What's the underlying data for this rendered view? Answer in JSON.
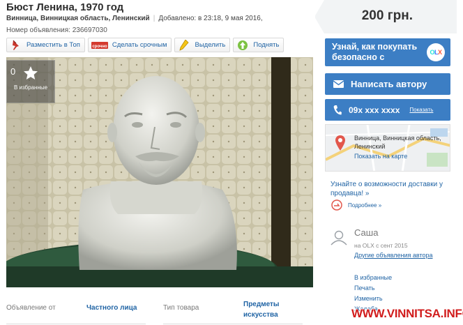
{
  "listing": {
    "title": "Бюст Ленина, 1970 год",
    "location": "Винница, Винницкая область, Ленинский",
    "added": "Добавлено: в 23:18, 9 мая 2016,",
    "ad_number": "Номер объявления: 236697030"
  },
  "actions": [
    {
      "label": "Разместить в Топ",
      "icon": "pin-icon"
    },
    {
      "label": "Сделать срочным",
      "icon": "urgent-badge-icon",
      "badge": "срочно"
    },
    {
      "label": "Выделить",
      "icon": "highlighter-icon"
    },
    {
      "label": "Поднять",
      "icon": "arrow-up-icon"
    }
  ],
  "photo": {
    "favorite_label": "В избранные",
    "favorite_prefix": "0"
  },
  "details": {
    "from_label": "Объявление от",
    "from_value": "Частного лица",
    "type_label": "Тип товара",
    "type_value": "Предметы искусства"
  },
  "sidebar": {
    "price": "200 грн.",
    "olx_promo": "Узнай, как покупать безопасно с",
    "olx_logo": "OLX",
    "message_button": "Написать автору",
    "phone": "09x xxx xxxx",
    "phone_show": "Показать",
    "map_location": "Винница, Винницкая область, Ленинский",
    "map_link": "Показать на карте",
    "delivery_text": "Узнайте о возможности доставки у продавца! »",
    "delivery_more": "Подробнее »",
    "seller_name": "Саша",
    "seller_since": "на OLX с сент 2015",
    "seller_other": "Другие объявления автора",
    "links": [
      "В избранные",
      "Печать",
      "Изменить",
      "Жалоба"
    ]
  },
  "watermark": "WWW.VINNITSA.INFO",
  "colors": {
    "accent_blue": "#3c7ec4",
    "link_blue": "#1f63a4",
    "watermark_red": "#d11c1c"
  }
}
